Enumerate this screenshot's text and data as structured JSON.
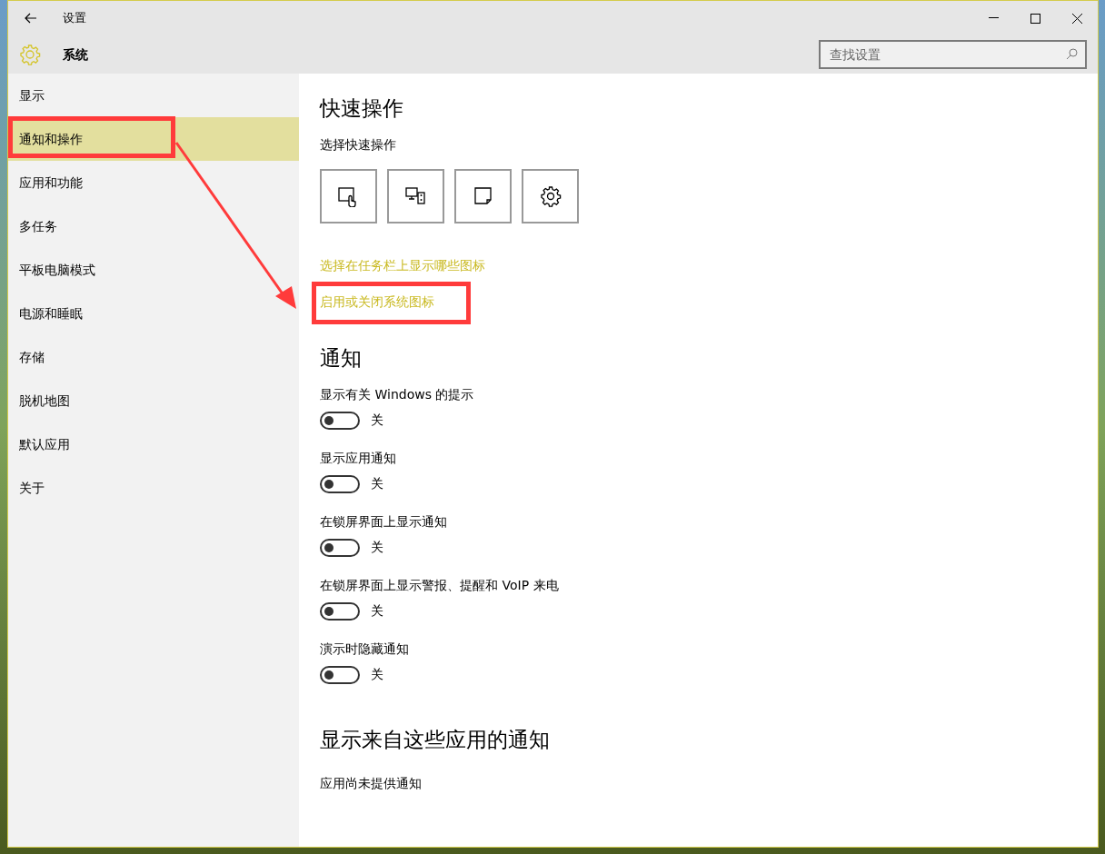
{
  "window": {
    "title": "设置",
    "section": "系统"
  },
  "search": {
    "placeholder": "查找设置"
  },
  "sidebar": {
    "items": [
      {
        "label": "显示",
        "selected": false
      },
      {
        "label": "通知和操作",
        "selected": true
      },
      {
        "label": "应用和功能",
        "selected": false
      },
      {
        "label": "多任务",
        "selected": false
      },
      {
        "label": "平板电脑模式",
        "selected": false
      },
      {
        "label": "电源和睡眠",
        "selected": false
      },
      {
        "label": "存储",
        "selected": false
      },
      {
        "label": "脱机地图",
        "selected": false
      },
      {
        "label": "默认应用",
        "selected": false
      },
      {
        "label": "关于",
        "selected": false
      }
    ]
  },
  "quick_actions": {
    "heading": "快速操作",
    "subheading": "选择快速操作",
    "tiles": [
      {
        "kind": "tablet"
      },
      {
        "kind": "project"
      },
      {
        "kind": "note"
      },
      {
        "kind": "settings"
      }
    ],
    "links": [
      "选择在任务栏上显示哪些图标",
      "启用或关闭系统图标"
    ]
  },
  "notifications": {
    "heading": "通知",
    "settings": [
      {
        "label": "显示有关 Windows 的提示",
        "on": false,
        "state_text": "关"
      },
      {
        "label": "显示应用通知",
        "on": false,
        "state_text": "关"
      },
      {
        "label": "在锁屏界面上显示通知",
        "on": false,
        "state_text": "关"
      },
      {
        "label": "在锁屏界面上显示警报、提醒和 VoIP 来电",
        "on": false,
        "state_text": "关"
      },
      {
        "label": "演示时隐藏通知",
        "on": false,
        "state_text": "关"
      }
    ]
  },
  "apps_section": {
    "heading": "显示来自这些应用的通知",
    "empty_text": "应用尚未提供通知"
  }
}
